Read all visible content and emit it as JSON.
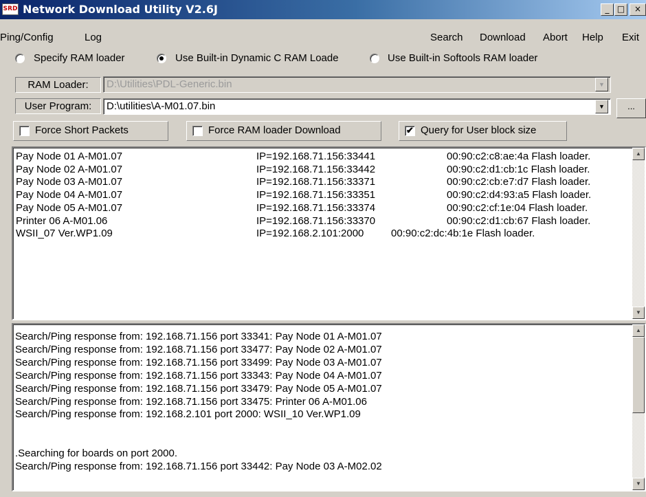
{
  "window": {
    "icon_text": "SRD",
    "title": "Network Download Utility V2.6J",
    "controls": [
      "_",
      "□",
      "×"
    ]
  },
  "menu": {
    "left": [
      "Ping/Config",
      "Log"
    ],
    "right": [
      "Search",
      "Download",
      "Abort",
      "Help",
      "Exit"
    ]
  },
  "ram_options": [
    {
      "label": "Specify RAM loader",
      "selected": false
    },
    {
      "label": "Use Built-in Dynamic C RAM Loade",
      "selected": true
    },
    {
      "label": "Use Built-in Softools  RAM loader",
      "selected": false
    }
  ],
  "ram_loader": {
    "label": "RAM Loader:",
    "value": "D:\\Utilities\\PDL-Generic.bin"
  },
  "user_program": {
    "label": "User Program:",
    "value": "D:\\utilities\\A-M01.07.bin"
  },
  "browse_label": "...",
  "combo_arrow": "▼",
  "options": [
    {
      "label": "Force Short Packets",
      "checked": false
    },
    {
      "label": "Force RAM loader Download",
      "checked": false
    },
    {
      "label": "Query for User block size",
      "checked": true
    }
  ],
  "devices": [
    {
      "name": "Pay Node 01 A-M01.07",
      "ip": "IP=192.168.71.156:33441",
      "mac": "00:90:c2:c8:ae:4a Flash loader."
    },
    {
      "name": "Pay Node 02 A-M01.07",
      "ip": "IP=192.168.71.156:33442",
      "mac": "00:90:c2:d1:cb:1c Flash loader."
    },
    {
      "name": "Pay Node 03 A-M01.07",
      "ip": "IP=192.168.71.156:33371",
      "mac": "00:90:c2:cb:e7:d7 Flash loader."
    },
    {
      "name": "Pay Node 04 A-M01.07",
      "ip": "IP=192.168.71.156:33351",
      "mac": "00:90:c2:d4:93:a5 Flash loader."
    },
    {
      "name": "Pay Node 05 A-M01.07",
      "ip": "IP=192.168.71.156:33374",
      "mac": "00:90:c2:cf:1e:04 Flash loader."
    },
    {
      "name": "Printer 06 A-M01.06",
      "ip": "IP=192.168.71.156:33370",
      "mac": "00:90:c2:d1:cb:67 Flash loader."
    },
    {
      "name": "WSII_07 Ver.WP1.09",
      "ip": "IP=192.168.2.101:2000",
      "mac": "00:90:c2:dc:4b:1e Flash loader."
    }
  ],
  "log_lines": [
    "Search/Ping response from: 192.168.71.156 port 33341: Pay Node 01  A-M01.07",
    "Search/Ping response from: 192.168.71.156 port 33477: Pay Node 02  A-M01.07",
    "Search/Ping response from: 192.168.71.156 port 33499: Pay Node 03  A-M01.07",
    "Search/Ping response from: 192.168.71.156 port 33343: Pay Node 04  A-M01.07",
    "Search/Ping response from: 192.168.71.156 port 33479: Pay Node 05  A-M01.07",
    "Search/Ping response from: 192.168.71.156 port 33475: Printer 06  A-M01.06",
    "Search/Ping response from: 192.168.2.101 port 2000: WSII_10 Ver.WP1.09",
    "",
    "",
    ".Searching for boards on port 2000.",
    "Search/Ping response from: 192.168.71.156 port 33442: Pay Node 03  A-M02.02"
  ],
  "scroll_arrows": {
    "up": "▲",
    "down": "▼"
  },
  "check_mark": "✔"
}
